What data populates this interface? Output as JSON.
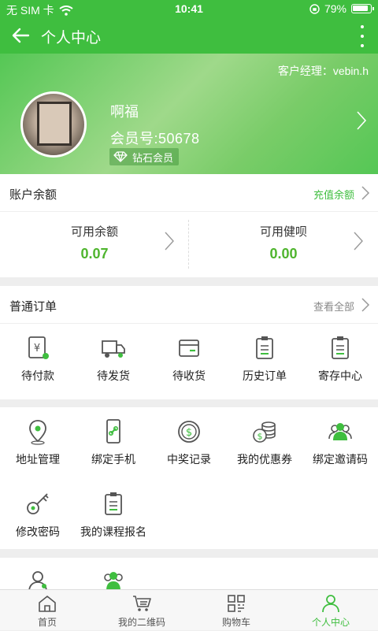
{
  "status_bar": {
    "carrier": "无 SIM 卡",
    "time": "10:41",
    "battery": "79%"
  },
  "nav": {
    "title": "个人中心"
  },
  "profile": {
    "manager": "客户经理：vebin.h",
    "nickname": "啊福",
    "member_no": "会员号:50678",
    "level": "钻石会员"
  },
  "account": {
    "title": "账户余额",
    "recharge": "充值余额",
    "available_balance_label": "可用余额",
    "available_balance_value": "0.07",
    "available_health_label": "可用健呗",
    "available_health_value": "0.00"
  },
  "orders": {
    "title": "普通订单",
    "view_all": "查看全部",
    "items": [
      {
        "label": "待付款",
        "icon": "pending-payment-icon"
      },
      {
        "label": "待发货",
        "icon": "truck-icon"
      },
      {
        "label": "待收货",
        "icon": "box-icon"
      },
      {
        "label": "历史订单",
        "icon": "clipboard-icon"
      },
      {
        "label": "寄存中心",
        "icon": "clipboard-icon"
      }
    ]
  },
  "services": {
    "items": [
      {
        "label": "地址管理",
        "icon": "location-pin-icon"
      },
      {
        "label": "绑定手机",
        "icon": "phone-link-icon"
      },
      {
        "label": "中奖记录",
        "icon": "dollar-coin-icon"
      },
      {
        "label": "我的优惠券",
        "icon": "coins-stack-icon"
      },
      {
        "label": "绑定邀请码",
        "icon": "users-icon"
      },
      {
        "label": "修改密码",
        "icon": "key-icon"
      },
      {
        "label": "我的课程报名",
        "icon": "clipboard-icon"
      }
    ]
  },
  "tabbar": {
    "items": [
      {
        "label": "首页",
        "icon": "home-icon"
      },
      {
        "label": "我的二维码",
        "icon": "qr-code-icon"
      },
      {
        "label": "购物车",
        "icon": "grid-cart-icon"
      },
      {
        "label": "个人中心",
        "icon": "person-icon"
      }
    ],
    "active_index": 3
  },
  "colors": {
    "brand_green": "#3fbe3f",
    "value_green": "#4fb52e",
    "icon_gray": "#555555"
  }
}
